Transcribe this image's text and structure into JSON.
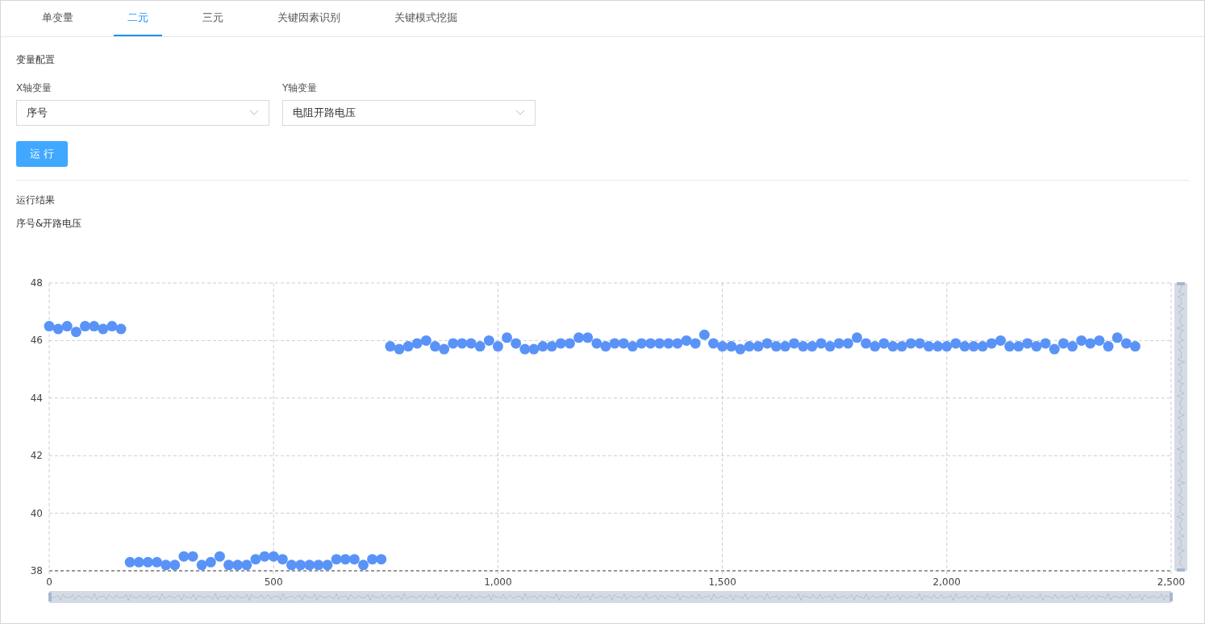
{
  "tabs": [
    {
      "label": "单变量",
      "selected": false
    },
    {
      "label": "二元",
      "selected": true
    },
    {
      "label": "三元",
      "selected": false
    },
    {
      "label": "关键因素识别",
      "selected": false
    },
    {
      "label": "关键模式挖掘",
      "selected": false
    }
  ],
  "config": {
    "title": "变量配置",
    "fields": [
      {
        "label": "X轴变量",
        "value": "序号"
      },
      {
        "label": "Y轴变量",
        "value": "电阻开路电压"
      }
    ],
    "run_button": "运 行"
  },
  "results": {
    "title": "运行结果",
    "chart_title": "序号&开路电压",
    "chart_data": {
      "type": "scatter",
      "xlim": [
        0,
        2500
      ],
      "ylim": [
        38,
        48
      ],
      "xticks": [
        0,
        {
          "value": 500,
          "label": "500"
        },
        {
          "value": 1000,
          "label": "1,000"
        },
        {
          "value": 1500,
          "label": "1,500"
        },
        {
          "value": 2000,
          "label": "2,000"
        },
        {
          "value": 2500,
          "label": "2,500"
        }
      ],
      "yticks": [
        38,
        40,
        42,
        44,
        46,
        48
      ],
      "x": [
        0,
        20,
        40,
        60,
        80,
        100,
        120,
        140,
        160,
        180,
        200,
        220,
        240,
        260,
        280,
        300,
        320,
        340,
        360,
        380,
        400,
        420,
        440,
        460,
        480,
        500,
        520,
        540,
        560,
        580,
        600,
        620,
        640,
        660,
        680,
        700,
        720,
        740,
        760,
        780,
        800,
        820,
        840,
        860,
        880,
        900,
        920,
        940,
        960,
        980,
        1000,
        1020,
        1040,
        1060,
        1080,
        1100,
        1120,
        1140,
        1160,
        1180,
        1200,
        1220,
        1240,
        1260,
        1280,
        1300,
        1320,
        1340,
        1360,
        1380,
        1400,
        1420,
        1440,
        1460,
        1480,
        1500,
        1520,
        1540,
        1560,
        1580,
        1600,
        1620,
        1640,
        1660,
        1680,
        1700,
        1720,
        1740,
        1760,
        1780,
        1800,
        1820,
        1840,
        1860,
        1880,
        1900,
        1920,
        1940,
        1960,
        1980,
        2000,
        2020,
        2040,
        2060,
        2080,
        2100,
        2120,
        2140,
        2160,
        2180,
        2200,
        2220,
        2240,
        2260,
        2280,
        2300,
        2320,
        2340,
        2360,
        2380,
        2400,
        2420
      ],
      "grid": true,
      "series": [
        {
          "color": "#5a93f8",
          "values": [
            46.5,
            46.4,
            46.5,
            46.3,
            46.5,
            46.5,
            46.4,
            46.5,
            46.4,
            38.3,
            38.3,
            38.3,
            38.3,
            38.2,
            38.2,
            38.5,
            38.5,
            38.2,
            38.3,
            38.5,
            38.2,
            38.2,
            38.2,
            38.4,
            38.5,
            38.5,
            38.4,
            38.2,
            38.2,
            38.2,
            38.2,
            38.2,
            38.4,
            38.4,
            38.4,
            38.2,
            38.4,
            38.4,
            45.8,
            45.7,
            45.8,
            45.9,
            46.0,
            45.8,
            45.7,
            45.9,
            45.9,
            45.9,
            45.8,
            46.0,
            45.8,
            46.1,
            45.9,
            45.7,
            45.7,
            45.8,
            45.8,
            45.9,
            45.9,
            46.1,
            46.1,
            45.9,
            45.8,
            45.9,
            45.9,
            45.8,
            45.9,
            45.9,
            45.9,
            45.9,
            45.9,
            46.0,
            45.9,
            46.2,
            45.9,
            45.8,
            45.8,
            45.7,
            45.8,
            45.8,
            45.9,
            45.8,
            45.8,
            45.9,
            45.8,
            45.8,
            45.9,
            45.8,
            45.9,
            45.9,
            46.1,
            45.9,
            45.8,
            45.9,
            45.8,
            45.8,
            45.9,
            45.9,
            45.8,
            45.8,
            45.8,
            45.9,
            45.8,
            45.8,
            45.8,
            45.9,
            46.0,
            45.8,
            45.8,
            45.9,
            45.8,
            45.9,
            45.7,
            45.9,
            45.8,
            46.0,
            45.9,
            46.0,
            45.8,
            46.1,
            45.9,
            45.8
          ]
        }
      ]
    }
  }
}
